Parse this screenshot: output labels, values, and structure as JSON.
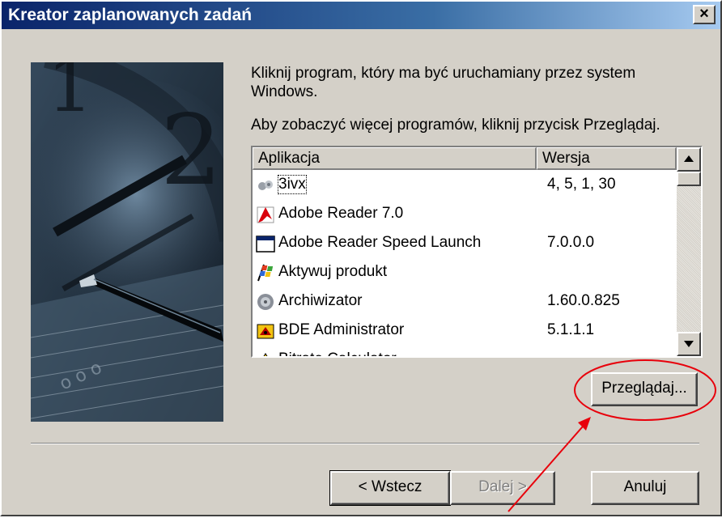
{
  "window": {
    "title": "Kreator zaplanowanych zadań",
    "close_symbol": "×"
  },
  "instructions": {
    "line1": "Kliknij program, który ma być uruchamiany przez system Windows.",
    "line2": "Aby zobaczyć więcej programów, kliknij przycisk Przeglądaj."
  },
  "list": {
    "columns": [
      "Aplikacja",
      "Wersja"
    ],
    "rows": [
      {
        "name": "3ivx",
        "version": "4, 5, 1, 30",
        "icon": "3ivx-icon"
      },
      {
        "name": "Adobe Reader 7.0",
        "version": "",
        "icon": "adobe-reader-icon"
      },
      {
        "name": "Adobe Reader Speed Launch",
        "version": "7.0.0.0",
        "icon": "window-icon"
      },
      {
        "name": "Aktywuj produkt",
        "version": "",
        "icon": "windows-flag-icon"
      },
      {
        "name": "Archiwizator",
        "version": "1.60.0.825",
        "icon": "archiver-icon"
      },
      {
        "name": "BDE Administrator",
        "version": "5.1.1.1",
        "icon": "bde-icon"
      },
      {
        "name": "Bitrate Calculator",
        "version": "",
        "icon": "calculator-icon"
      }
    ]
  },
  "buttons": {
    "browse": "Przeglądaj...",
    "back": "< Wstecz",
    "next": "Dalej >",
    "cancel": "Anuluj"
  },
  "colors": {
    "titlebar": "#0a246a",
    "annotation": "#e8000b",
    "face": "#d4d0c8"
  }
}
